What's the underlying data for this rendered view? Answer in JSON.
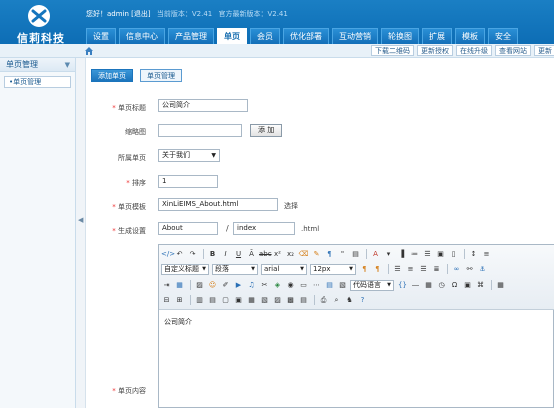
{
  "brand": {
    "name": "信莉科技"
  },
  "topbar": {
    "greeting": "您好！admin [退出]",
    "current_version": "当前版本：V2.41",
    "latest_version": "官方最新版本：V2.41"
  },
  "nav": {
    "tabs": [
      "设置",
      "信息中心",
      "产品管理",
      "单页",
      "会员",
      "优化部署",
      "互动营销",
      "轮换图",
      "扩展",
      "模板",
      "安全"
    ],
    "active_index": 3
  },
  "quick_links": [
    "下载二维码",
    "更新授权",
    "在线升级",
    "查看网站",
    "更新"
  ],
  "sidebar": {
    "title": "单页管理",
    "collapse_glyph": "▼",
    "items": [
      "•单页管理"
    ]
  },
  "content_tabs": [
    "添加单页",
    "单页管理"
  ],
  "form": {
    "title_label": "单页标题",
    "title_value": "公司简介",
    "thumb_label": "缩略图",
    "thumb_value": "",
    "thumb_button": "添 加",
    "parent_label": "所属单页",
    "parent_value": "关于我们",
    "order_label": "排序",
    "order_value": "1",
    "template_label": "单页模板",
    "template_value": "XinLiEIMS_About.html",
    "template_choose": "选择",
    "gen_label": "生成设置",
    "gen_dir": "About",
    "gen_sep": "/",
    "gen_file": "index",
    "gen_ext": ".html",
    "content_label": "单页内容",
    "content_value": "公司简介"
  },
  "editor": {
    "style_select": "自定义标题",
    "paragraph_select": "段落",
    "font_select": "arial",
    "size_select": "12px",
    "code_lang_select": "代码语言"
  }
}
